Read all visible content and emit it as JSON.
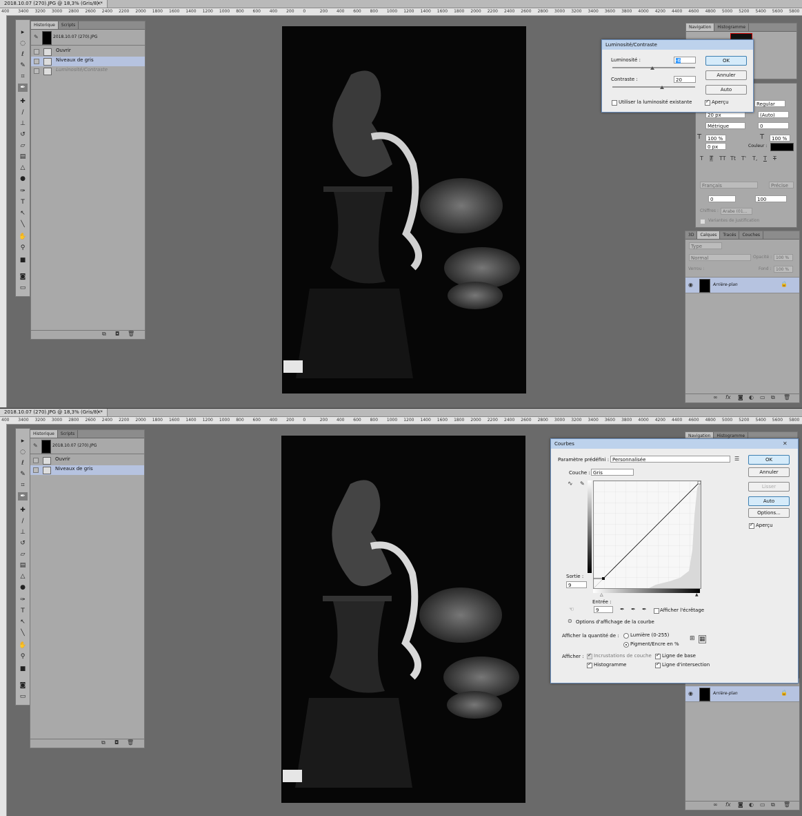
{
  "document": {
    "tab_title": "2018.10.07 (270).JPG @ 18,3% (Gris/8) *",
    "ruler_ticks": [
      "400",
      "3400",
      "3200",
      "3000",
      "2800",
      "2600",
      "2400",
      "2200",
      "2000",
      "1800",
      "1600",
      "1400",
      "1200",
      "1000",
      "800",
      "600",
      "400",
      "200",
      "0",
      "200",
      "400",
      "600",
      "800",
      "1000",
      "1200",
      "1400",
      "1600",
      "1800",
      "2000",
      "2200",
      "2400",
      "2600",
      "2800",
      "3000",
      "3200",
      "3400",
      "3600",
      "3800",
      "4000",
      "4200",
      "4400",
      "4600",
      "4800",
      "5000",
      "5200",
      "5400",
      "5600",
      "5800"
    ]
  },
  "history_panel": {
    "tabs": [
      "Historique",
      "Scripts"
    ],
    "snapshot": "2018.10.07 (270).JPG",
    "states_top": [
      "Ouvrir",
      "Niveaux de gris",
      "Luminosité/Contraste"
    ],
    "states_bottom": [
      "Ouvrir",
      "Niveaux de gris"
    ]
  },
  "nav_panel": {
    "tabs": [
      "Navigation",
      "Histogramme"
    ]
  },
  "char_panel": {
    "style": "Regular",
    "size": "20 px",
    "leading": "(Auto)",
    "kerning": "Métrique",
    "tracking": "0",
    "vscale": "100 %",
    "hscale": "100 %",
    "baseline": "0 px",
    "color_label": "Couleur :",
    "language": "Français",
    "aa": "Précise",
    "num1": "0",
    "num2": "100",
    "digits_label": "Chiffres :",
    "digits_value": "Arabe (01...",
    "justif": "Variantes de justification",
    "type_buttons": [
      "T",
      "T",
      "TT",
      "Tt",
      "T'",
      "T,",
      "T",
      "T"
    ]
  },
  "layers_panel": {
    "tabs": [
      "3D",
      "Calques",
      "Tracés",
      "Couches"
    ],
    "filter": "Type",
    "blend": "Normal",
    "opacity_label": "Opacité :",
    "opacity": "100 %",
    "lock_label": "Verrou :",
    "fill_label": "Fond :",
    "fill": "100 %",
    "layer_name": "Arrière-plan"
  },
  "brightness_dialog": {
    "title": "Luminosité/Contraste",
    "brightness_label": "Luminosité :",
    "brightness_value": "-6",
    "contrast_label": "Contraste :",
    "contrast_value": "20",
    "legacy_label": "Utiliser la luminosité existante",
    "ok": "OK",
    "cancel": "Annuler",
    "auto": "Auto",
    "preview": "Aperçu"
  },
  "curves_dialog": {
    "title": "Courbes",
    "close": "✕",
    "preset_label": "Paramètre prédéfini :",
    "preset_value": "Personnalisée",
    "channel_label": "Couche :",
    "channel_value": "Gris",
    "output_label": "Sortie :",
    "output_value": "9",
    "input_label": "Entrée :",
    "input_value": "9",
    "clipping_label": "Afficher l'écrêtage",
    "curve_options": "Options d'affichage de la courbe",
    "amount_label": "Afficher la quantité de :",
    "light": "Lumière (0-255)",
    "pigment": "Pigment/Encre en %",
    "show_label": "Afficher :",
    "overlays": "Incrustations de couche",
    "baseline": "Ligne de base",
    "histogram": "Histogramme",
    "intersection": "Ligne d'intersection",
    "ok": "OK",
    "cancel": "Annuler",
    "smooth": "Lisser",
    "auto": "Auto",
    "options": "Options...",
    "preview": "Aperçu"
  }
}
